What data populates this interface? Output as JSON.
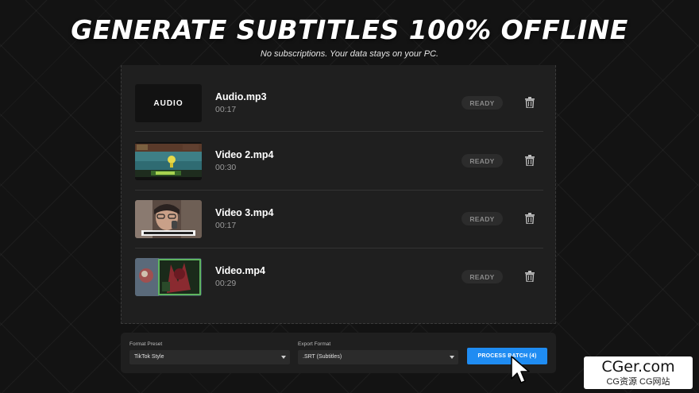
{
  "header": {
    "title": "GENERATE SUBTITLES 100% OFFLINE",
    "subtitle": "No subscriptions. Your data stays on your PC."
  },
  "files": [
    {
      "name": "Audio.mp3",
      "duration": "00:17",
      "status": "READY",
      "thumb_label": "AUDIO"
    },
    {
      "name": "Video 2.mp4",
      "duration": "00:30",
      "status": "READY"
    },
    {
      "name": "Video 3.mp4",
      "duration": "00:17",
      "status": "READY"
    },
    {
      "name": "Video.mp4",
      "duration": "00:29",
      "status": "READY"
    }
  ],
  "controls": {
    "format_preset_label": "Format Preset",
    "format_preset_value": "TikTok Style",
    "export_format_label": "Export Format",
    "export_format_value": ".SRT (Subtitles)",
    "process_button_label": "PROCESS BATCH (4)"
  },
  "icons": {
    "delete": "trash-icon",
    "dropdown": "chevron-down-icon",
    "pointer": "mouse-cursor-icon"
  },
  "colors": {
    "accent": "#1f8cf2",
    "panel": "#1f1f1f",
    "background": "#131313",
    "badge": "#2c2c2c"
  },
  "watermark": {
    "logo": "CGer.com",
    "tagline": "CG资源 CG网站"
  }
}
